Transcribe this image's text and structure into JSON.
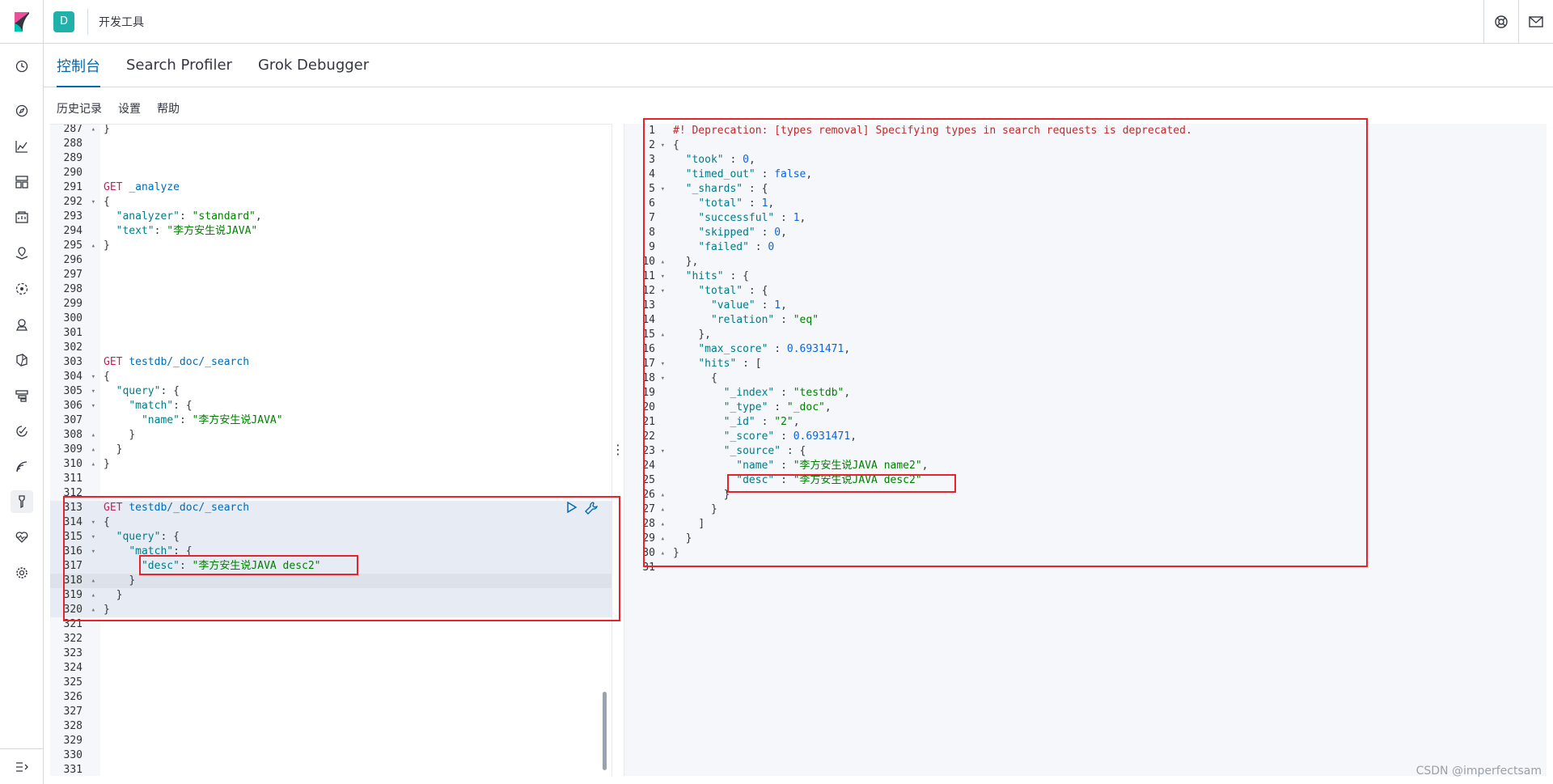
{
  "header": {
    "space_initial": "D",
    "breadcrumb": "开发工具"
  },
  "tabs": [
    {
      "label": "控制台",
      "active": true
    },
    {
      "label": "Search Profiler",
      "active": false
    },
    {
      "label": "Grok Debugger",
      "active": false
    }
  ],
  "toolbar": {
    "history": "历史记录",
    "settings": "设置",
    "help": "帮助"
  },
  "request_editor": {
    "lines": [
      {
        "n": "287",
        "fold": "▴",
        "html": "<span class='pn'>}</span>"
      },
      {
        "n": "288",
        "fold": "",
        "html": ""
      },
      {
        "n": "289",
        "fold": "",
        "html": ""
      },
      {
        "n": "290",
        "fold": "",
        "html": ""
      },
      {
        "n": "291",
        "fold": "",
        "html": "<span class='k'>GET</span> <span class='p'>_analyze</span>"
      },
      {
        "n": "292",
        "fold": "▾",
        "html": "<span class='pn'>{</span>"
      },
      {
        "n": "293",
        "fold": "",
        "html": "  <span class='n'>\"analyzer\"</span><span class='pn'>: </span><span class='s'>\"standard\"</span><span class='pn'>,</span>"
      },
      {
        "n": "294",
        "fold": "",
        "html": "  <span class='n'>\"text\"</span><span class='pn'>: </span><span class='s'>\"李方安生说JAVA\"</span>"
      },
      {
        "n": "295",
        "fold": "▴",
        "html": "<span class='pn'>}</span>"
      },
      {
        "n": "296",
        "fold": "",
        "html": ""
      },
      {
        "n": "297",
        "fold": "",
        "html": ""
      },
      {
        "n": "298",
        "fold": "",
        "html": ""
      },
      {
        "n": "299",
        "fold": "",
        "html": ""
      },
      {
        "n": "300",
        "fold": "",
        "html": ""
      },
      {
        "n": "301",
        "fold": "",
        "html": ""
      },
      {
        "n": "302",
        "fold": "",
        "html": ""
      },
      {
        "n": "303",
        "fold": "",
        "html": "<span class='k'>GET</span> <span class='p'>testdb/_doc/_search</span>"
      },
      {
        "n": "304",
        "fold": "▾",
        "html": "<span class='pn'>{</span>"
      },
      {
        "n": "305",
        "fold": "▾",
        "html": "  <span class='n'>\"query\"</span><span class='pn'>: {</span>"
      },
      {
        "n": "306",
        "fold": "▾",
        "html": "    <span class='n'>\"match\"</span><span class='pn'>: {</span>"
      },
      {
        "n": "307",
        "fold": "",
        "html": "      <span class='n'>\"name\"</span><span class='pn'>: </span><span class='s'>\"李方安生说JAVA\"</span>"
      },
      {
        "n": "308",
        "fold": "▴",
        "html": "    <span class='pn'>}</span>"
      },
      {
        "n": "309",
        "fold": "▴",
        "html": "  <span class='pn'>}</span>"
      },
      {
        "n": "310",
        "fold": "▴",
        "html": "<span class='pn'>}</span>"
      },
      {
        "n": "311",
        "fold": "",
        "html": ""
      },
      {
        "n": "312",
        "fold": "",
        "html": ""
      },
      {
        "n": "313",
        "fold": "",
        "html": "<span class='k'>GET</span> <span class='p'>testdb/_doc/_search</span>"
      },
      {
        "n": "314",
        "fold": "▾",
        "html": "<span class='pn'>{</span>"
      },
      {
        "n": "315",
        "fold": "▾",
        "html": "  <span class='n'>\"query\"</span><span class='pn'>: {</span>"
      },
      {
        "n": "316",
        "fold": "▾",
        "html": "    <span class='n'>\"match\"</span><span class='pn'>: {</span>"
      },
      {
        "n": "317",
        "fold": "",
        "html": "      <span class='n'>\"desc\"</span><span class='pn'>: </span><span class='s'>\"李方安生说JAVA desc2\"</span>"
      },
      {
        "n": "318",
        "fold": "▴",
        "html": "    <span class='pn'>}</span>"
      },
      {
        "n": "319",
        "fold": "▴",
        "html": "  <span class='pn'>}</span>"
      },
      {
        "n": "320",
        "fold": "▴",
        "html": "<span class='pn'>}</span>"
      },
      {
        "n": "321",
        "fold": "",
        "html": ""
      },
      {
        "n": "322",
        "fold": "",
        "html": ""
      },
      {
        "n": "323",
        "fold": "",
        "html": ""
      },
      {
        "n": "324",
        "fold": "",
        "html": ""
      },
      {
        "n": "325",
        "fold": "",
        "html": ""
      },
      {
        "n": "326",
        "fold": "",
        "html": ""
      },
      {
        "n": "327",
        "fold": "",
        "html": ""
      },
      {
        "n": "328",
        "fold": "",
        "html": ""
      },
      {
        "n": "329",
        "fold": "",
        "html": ""
      },
      {
        "n": "330",
        "fold": "",
        "html": ""
      },
      {
        "n": "331",
        "fold": "",
        "html": ""
      }
    ]
  },
  "response_editor": {
    "lines": [
      {
        "n": "1",
        "fold": "",
        "html": "<span class='cmt'>#! Deprecation: [types removal] Specifying types in search requests is deprecated.</span>"
      },
      {
        "n": "2",
        "fold": "▾",
        "html": "<span class='pn'>{</span>"
      },
      {
        "n": "3",
        "fold": "",
        "html": "  <span class='n'>\"took\"</span><span class='pn'> : </span><span class='b'>0</span><span class='pn'>,</span>"
      },
      {
        "n": "4",
        "fold": "",
        "html": "  <span class='n'>\"timed_out\"</span><span class='pn'> : </span><span class='b'>false</span><span class='pn'>,</span>"
      },
      {
        "n": "5",
        "fold": "▾",
        "html": "  <span class='n'>\"_shards\"</span><span class='pn'> : {</span>"
      },
      {
        "n": "6",
        "fold": "",
        "html": "    <span class='n'>\"total\"</span><span class='pn'> : </span><span class='b'>1</span><span class='pn'>,</span>"
      },
      {
        "n": "7",
        "fold": "",
        "html": "    <span class='n'>\"successful\"</span><span class='pn'> : </span><span class='b'>1</span><span class='pn'>,</span>"
      },
      {
        "n": "8",
        "fold": "",
        "html": "    <span class='n'>\"skipped\"</span><span class='pn'> : </span><span class='b'>0</span><span class='pn'>,</span>"
      },
      {
        "n": "9",
        "fold": "",
        "html": "    <span class='n'>\"failed\"</span><span class='pn'> : </span><span class='b'>0</span>"
      },
      {
        "n": "10",
        "fold": "▴",
        "html": "  <span class='pn'>},</span>"
      },
      {
        "n": "11",
        "fold": "▾",
        "html": "  <span class='n'>\"hits\"</span><span class='pn'> : {</span>"
      },
      {
        "n": "12",
        "fold": "▾",
        "html": "    <span class='n'>\"total\"</span><span class='pn'> : {</span>"
      },
      {
        "n": "13",
        "fold": "",
        "html": "      <span class='n'>\"value\"</span><span class='pn'> : </span><span class='b'>1</span><span class='pn'>,</span>"
      },
      {
        "n": "14",
        "fold": "",
        "html": "      <span class='n'>\"relation\"</span><span class='pn'> : </span><span class='s'>\"eq\"</span>"
      },
      {
        "n": "15",
        "fold": "▴",
        "html": "    <span class='pn'>},</span>"
      },
      {
        "n": "16",
        "fold": "",
        "html": "    <span class='n'>\"max_score\"</span><span class='pn'> : </span><span class='b'>0.6931471</span><span class='pn'>,</span>"
      },
      {
        "n": "17",
        "fold": "▾",
        "html": "    <span class='n'>\"hits\"</span><span class='pn'> : [</span>"
      },
      {
        "n": "18",
        "fold": "▾",
        "html": "      <span class='pn'>{</span>"
      },
      {
        "n": "19",
        "fold": "",
        "html": "        <span class='n'>\"_index\"</span><span class='pn'> : </span><span class='s'>\"testdb\"</span><span class='pn'>,</span>"
      },
      {
        "n": "20",
        "fold": "",
        "html": "        <span class='n'>\"_type\"</span><span class='pn'> : </span><span class='s'>\"_doc\"</span><span class='pn'>,</span>"
      },
      {
        "n": "21",
        "fold": "",
        "html": "        <span class='n'>\"_id\"</span><span class='pn'> : </span><span class='s'>\"2\"</span><span class='pn'>,</span>"
      },
      {
        "n": "22",
        "fold": "",
        "html": "        <span class='n'>\"_score\"</span><span class='pn'> : </span><span class='b'>0.6931471</span><span class='pn'>,</span>"
      },
      {
        "n": "23",
        "fold": "▾",
        "html": "        <span class='n'>\"_source\"</span><span class='pn'> : {</span>"
      },
      {
        "n": "24",
        "fold": "",
        "html": "          <span class='n'>\"name\"</span><span class='pn'> : </span><span class='s'>\"李方安生说JAVA name2\"</span><span class='pn'>,</span>"
      },
      {
        "n": "25",
        "fold": "",
        "html": "          <span class='n'>\"desc\"</span><span class='pn'> : </span><span class='s'>\"李方安生说JAVA desc2\"</span>"
      },
      {
        "n": "26",
        "fold": "▴",
        "html": "        <span class='pn'>}</span>"
      },
      {
        "n": "27",
        "fold": "▴",
        "html": "      <span class='pn'>}</span>"
      },
      {
        "n": "28",
        "fold": "▴",
        "html": "    <span class='pn'>]</span>"
      },
      {
        "n": "29",
        "fold": "▴",
        "html": "  <span class='pn'>}</span>"
      },
      {
        "n": "30",
        "fold": "▴",
        "html": "<span class='pn'>}</span>"
      },
      {
        "n": "31",
        "fold": "",
        "html": ""
      }
    ]
  },
  "watermark": "CSDN @imperfectsam"
}
